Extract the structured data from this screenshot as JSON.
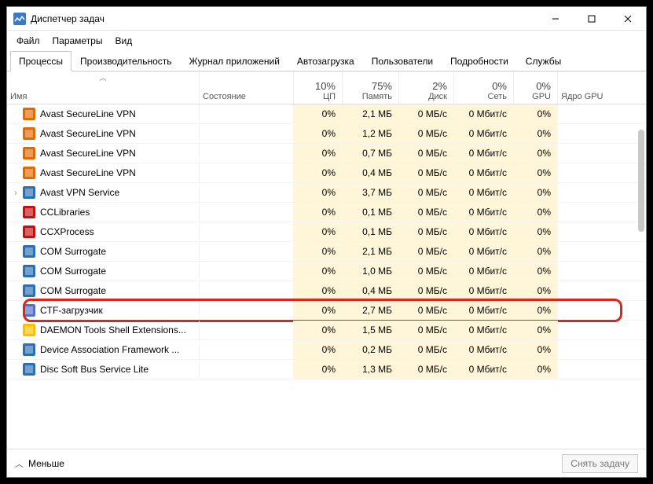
{
  "window": {
    "title": "Диспетчер задач"
  },
  "menu": {
    "file": "Файл",
    "options": "Параметры",
    "view": "Вид"
  },
  "tabs": {
    "processes": "Процессы",
    "performance": "Производительность",
    "app_history": "Журнал приложений",
    "startup": "Автозагрузка",
    "users": "Пользователи",
    "details": "Подробности",
    "services": "Службы"
  },
  "columns": {
    "name": "Имя",
    "status": "Состояние",
    "cpu_pct": "10%",
    "cpu_lbl": "ЦП",
    "mem_pct": "75%",
    "mem_lbl": "Память",
    "disk_pct": "2%",
    "disk_lbl": "Диск",
    "net_pct": "0%",
    "net_lbl": "Сеть",
    "gpu_pct": "0%",
    "gpu_lbl": "GPU",
    "gpucore_lbl": "Ядро GPU"
  },
  "rows": [
    {
      "expand": "",
      "icon": "#e06a00",
      "icon_kind": "shield-orange",
      "name": "Avast SecureLine VPN",
      "cpu": "0%",
      "mem": "2,1 МБ",
      "disk": "0 МБ/с",
      "net": "0 Мбит/с",
      "gpu": "0%"
    },
    {
      "expand": "",
      "icon": "#e06a00",
      "icon_kind": "square-orange",
      "name": "Avast SecureLine VPN",
      "cpu": "0%",
      "mem": "1,2 МБ",
      "disk": "0 МБ/с",
      "net": "0 Мбит/с",
      "gpu": "0%"
    },
    {
      "expand": "",
      "icon": "#e06a00",
      "icon_kind": "square-orange",
      "name": "Avast SecureLine VPN",
      "cpu": "0%",
      "mem": "0,7 МБ",
      "disk": "0 МБ/с",
      "net": "0 Мбит/с",
      "gpu": "0%"
    },
    {
      "expand": "",
      "icon": "#e06a00",
      "icon_kind": "square-orange",
      "name": "Avast SecureLine VPN",
      "cpu": "0%",
      "mem": "0,4 МБ",
      "disk": "0 МБ/с",
      "net": "0 Мбит/с",
      "gpu": "0%"
    },
    {
      "expand": "›",
      "icon": "#2b6fb3",
      "icon_kind": "app-blue",
      "name": "Avast VPN Service",
      "cpu": "0%",
      "mem": "3,7 МБ",
      "disk": "0 МБ/с",
      "net": "0 Мбит/с",
      "gpu": "0%"
    },
    {
      "expand": "",
      "icon": "#c41010",
      "icon_kind": "cc-red",
      "name": "CCLibraries",
      "cpu": "0%",
      "mem": "0,1 МБ",
      "disk": "0 МБ/с",
      "net": "0 Мбит/с",
      "gpu": "0%"
    },
    {
      "expand": "",
      "icon": "#c41010",
      "icon_kind": "cc-red",
      "name": "CCXProcess",
      "cpu": "0%",
      "mem": "0,1 МБ",
      "disk": "0 МБ/с",
      "net": "0 Мбит/с",
      "gpu": "0%"
    },
    {
      "expand": "",
      "icon": "#2b6fb3",
      "icon_kind": "app-blue",
      "name": "COM Surrogate",
      "cpu": "0%",
      "mem": "2,1 МБ",
      "disk": "0 МБ/с",
      "net": "0 Мбит/с",
      "gpu": "0%"
    },
    {
      "expand": "",
      "icon": "#2b6fb3",
      "icon_kind": "app-blue",
      "name": "COM Surrogate",
      "cpu": "0%",
      "mem": "1,0 МБ",
      "disk": "0 МБ/с",
      "net": "0 Мбит/с",
      "gpu": "0%"
    },
    {
      "expand": "",
      "icon": "#2b6fb3",
      "icon_kind": "app-blue",
      "name": "COM Surrogate",
      "cpu": "0%",
      "mem": "0,4 МБ",
      "disk": "0 МБ/с",
      "net": "0 Мбит/с",
      "gpu": "0%"
    },
    {
      "expand": "",
      "icon": "#5570c0",
      "icon_kind": "ctf-icon",
      "name": "CTF-загрузчик",
      "cpu": "0%",
      "mem": "2,7 МБ",
      "disk": "0 МБ/с",
      "net": "0 Мбит/с",
      "gpu": "0%",
      "highlight": true
    },
    {
      "expand": "",
      "icon": "#f7c100",
      "icon_kind": "daemon-yellow",
      "name": "DAEMON Tools Shell Extensions...",
      "cpu": "0%",
      "mem": "1,5 МБ",
      "disk": "0 МБ/с",
      "net": "0 Мбит/с",
      "gpu": "0%"
    },
    {
      "expand": "",
      "icon": "#2b6fb3",
      "icon_kind": "app-blue",
      "name": "Device Association Framework ...",
      "cpu": "0%",
      "mem": "0,2 МБ",
      "disk": "0 МБ/с",
      "net": "0 Мбит/с",
      "gpu": "0%"
    },
    {
      "expand": "",
      "icon": "#2b6fb3",
      "icon_kind": "app-blue",
      "name": "Disc Soft Bus Service Lite",
      "cpu": "0%",
      "mem": "1,3 МБ",
      "disk": "0 МБ/с",
      "net": "0 Мбит/с",
      "gpu": "0%"
    }
  ],
  "footer": {
    "less": "Меньше",
    "end_task": "Снять задачу"
  }
}
